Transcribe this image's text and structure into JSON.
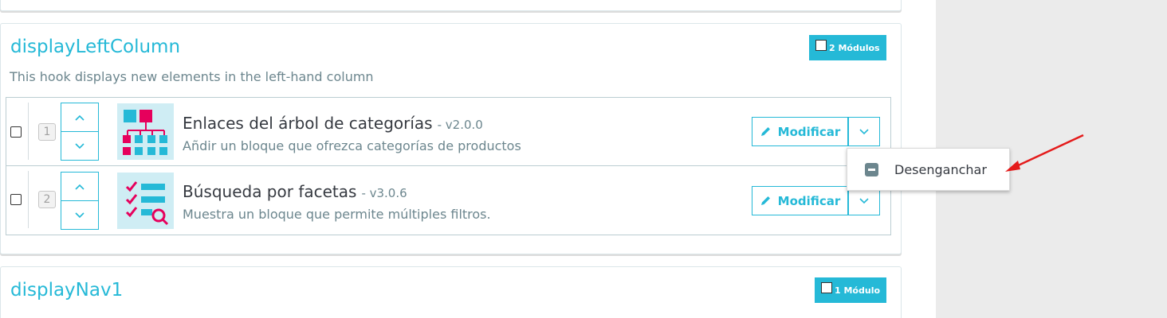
{
  "hook_left": {
    "title": "displayLeftColumn",
    "description": "This hook displays new elements in the left-hand column",
    "badge_label": "2 Módulos",
    "modules": [
      {
        "position": "1",
        "name": "Enlaces del árbol de categorías",
        "version": "- v2.0.0",
        "description": "Añdir un bloque que ofrezca categorías de productos",
        "icon": "category-tree-icon",
        "edit_label": "Modificar"
      },
      {
        "position": "2",
        "name": "Búsqueda por facetas",
        "version": "- v3.0.6",
        "description": "Muestra un bloque que permite múltiples filtros.",
        "icon": "faceted-search-icon",
        "edit_label": "Modificar"
      }
    ]
  },
  "dropdown": {
    "item_label": "Desenganchar",
    "item_icon": "minus-square-icon"
  },
  "hook_nav": {
    "title": "displayNav1",
    "badge_label": "1 Módulo"
  },
  "colors": {
    "accent": "#25b9d7",
    "pink": "#e6005c",
    "text": "#363a41",
    "muted": "#6c868e",
    "arrow": "#e41b1b"
  }
}
